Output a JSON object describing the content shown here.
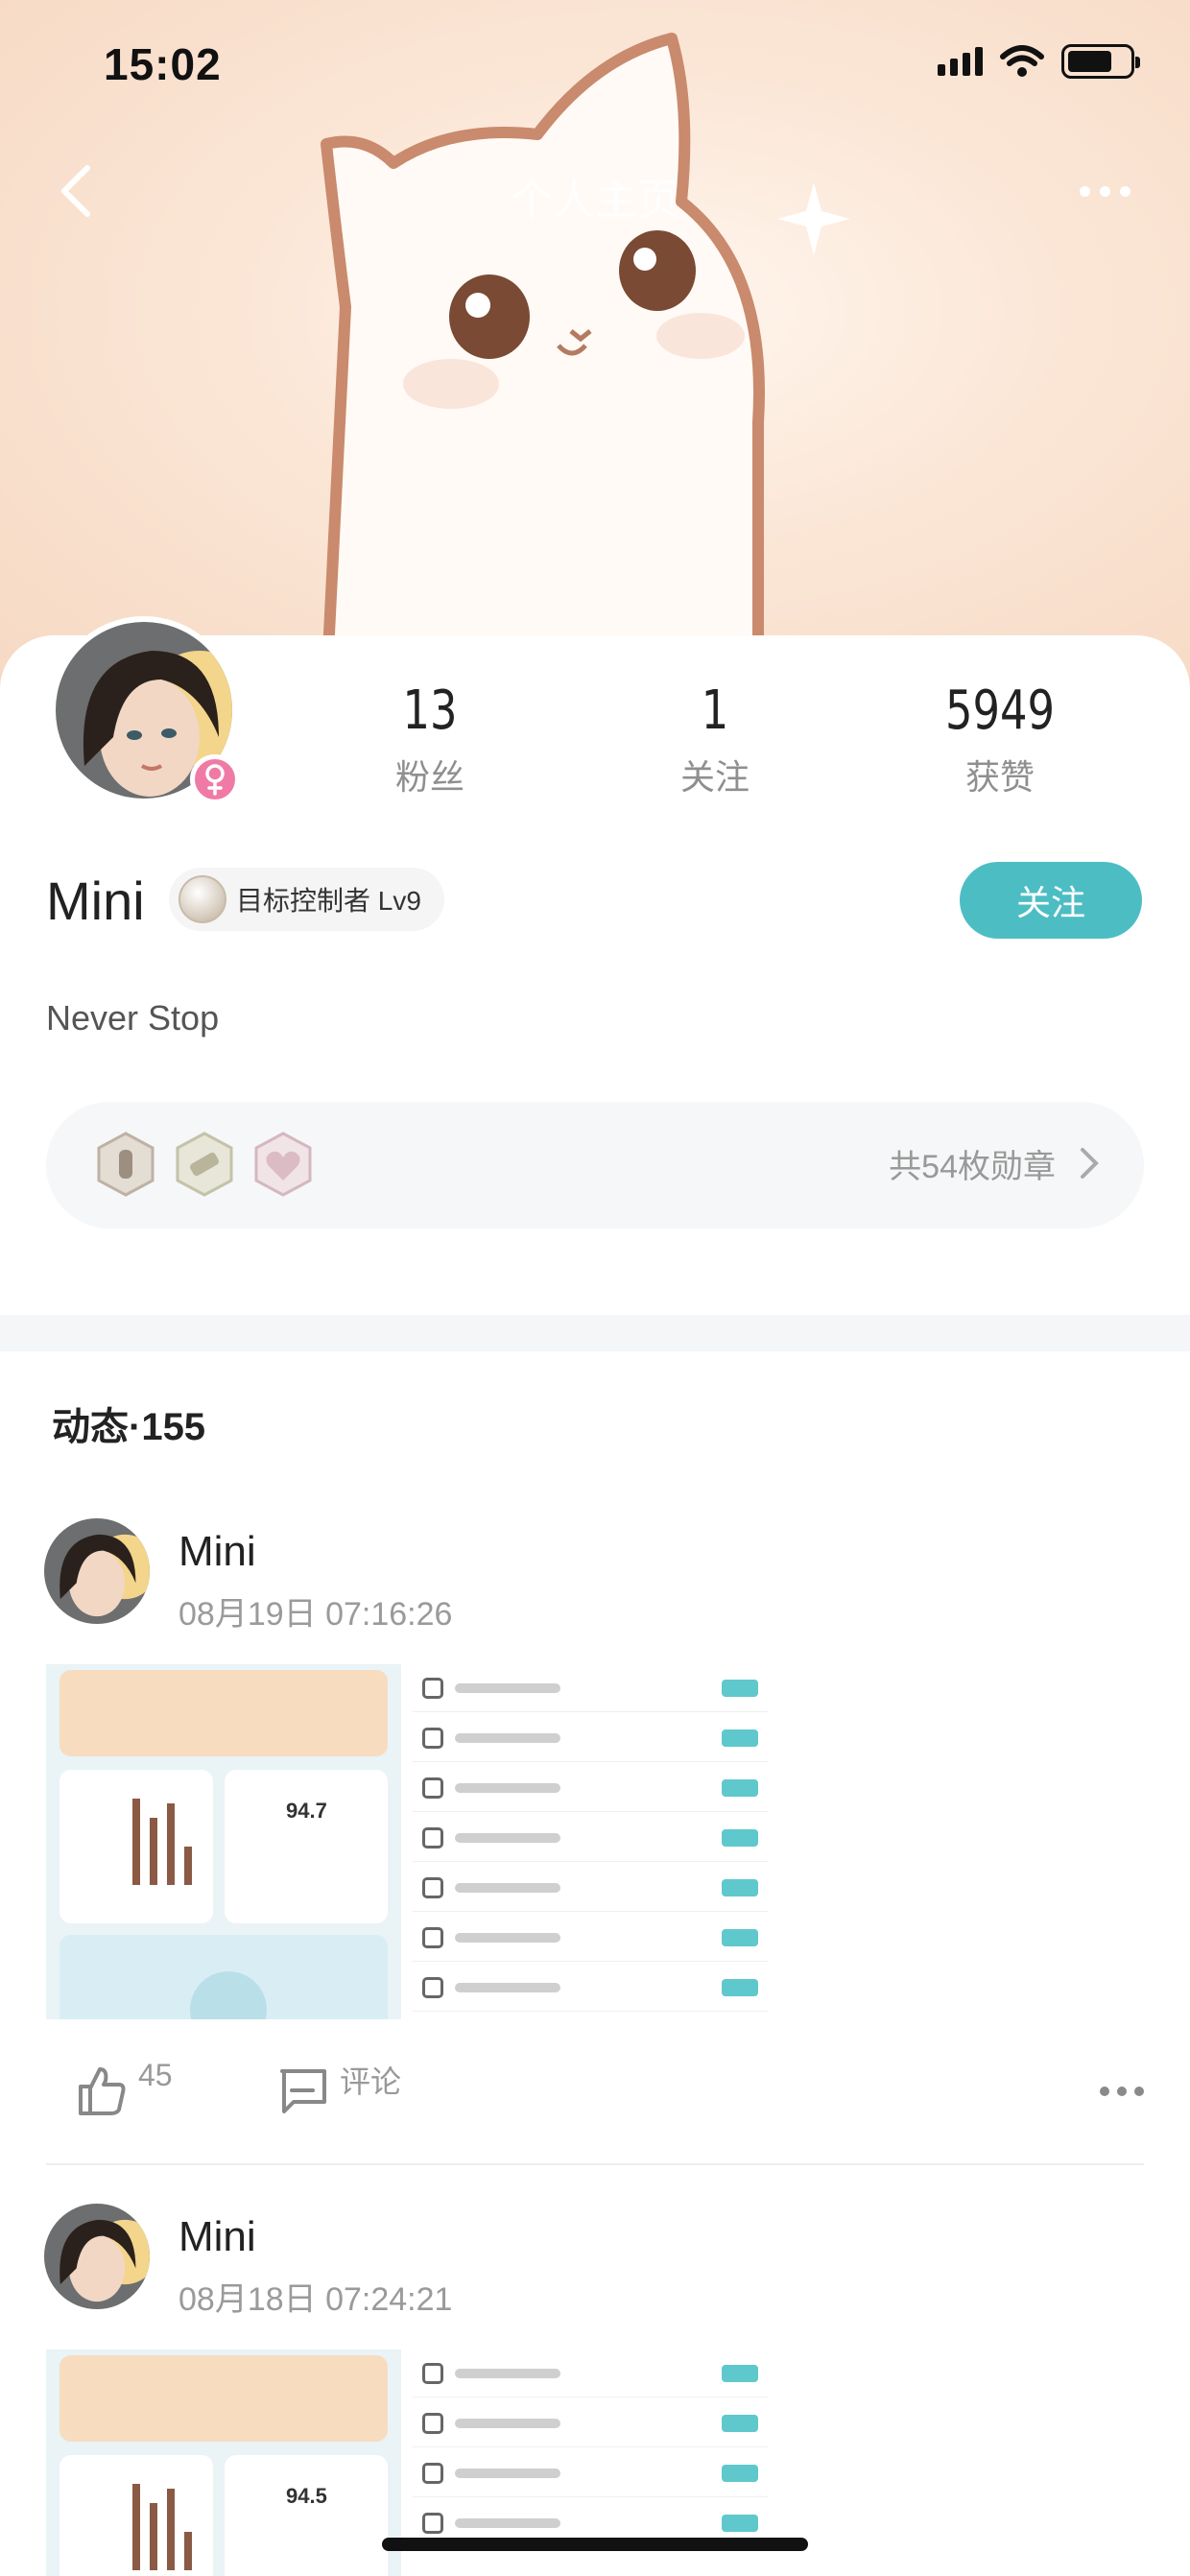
{
  "status_bar": {
    "time": "15:02"
  },
  "nav": {
    "title": "个人主页"
  },
  "profile": {
    "name": "Mini",
    "level_badge": "目标控制者 Lv9",
    "follow_label": "关注",
    "bio": "Never Stop",
    "stats": [
      {
        "value": "13",
        "label": "粉丝"
      },
      {
        "value": "1",
        "label": "关注"
      },
      {
        "value": "5949",
        "label": "获赞"
      }
    ],
    "medals_summary": "共54枚勋章"
  },
  "feed": {
    "title": "动态·155",
    "posts": [
      {
        "author": "Mini",
        "time": "08月19日  07:16:26",
        "likes": "45",
        "comment_label": "评论",
        "thumb_value": "94.7"
      },
      {
        "author": "Mini",
        "time": "08月18日  07:24:21",
        "thumb_value": "94.5"
      }
    ]
  },
  "colors": {
    "accent": "#4dbdc4",
    "gender_badge": "#f07aa6"
  },
  "icons": [
    "back-icon",
    "more-icon",
    "female-icon",
    "medal-icon",
    "chevron-right-icon",
    "thumbs-up-icon",
    "comment-icon",
    "signal-icon",
    "wifi-icon",
    "battery-icon"
  ]
}
